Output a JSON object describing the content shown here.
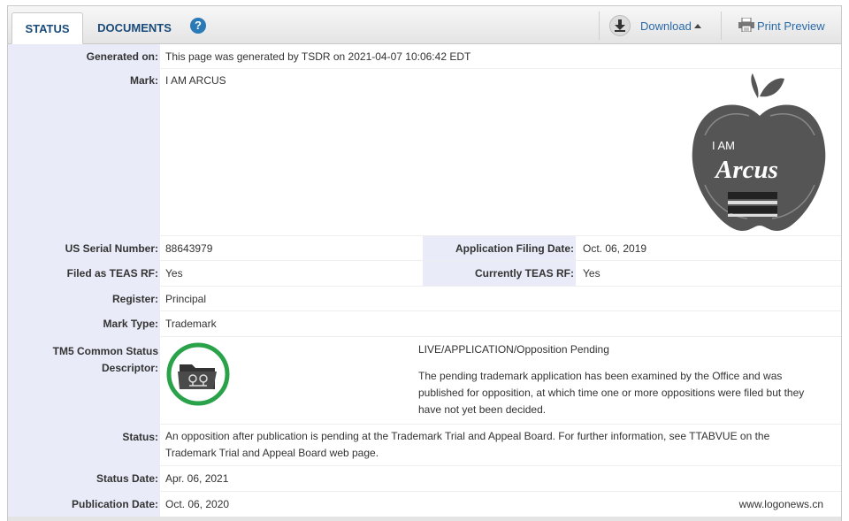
{
  "tabs": {
    "status": "STATUS",
    "documents": "DOCUMENTS",
    "help": "?"
  },
  "toolbar": {
    "download": "Download",
    "print_preview": "Print Preview"
  },
  "generated_on": {
    "label": "Generated on:",
    "value": "This page was generated by TSDR on 2021-04-07 10:06:42 EDT"
  },
  "mark": {
    "label": "Mark:",
    "value": "I AM ARCUS",
    "logo_text_small": "I AM",
    "logo_text_large": "Arcus"
  },
  "serial": {
    "label": "US Serial Number:",
    "value": "88643979"
  },
  "filing_date": {
    "label": "Application Filing Date:",
    "value": "Oct. 06, 2019"
  },
  "teas_rf": {
    "label": "Filed as TEAS RF:",
    "value": "Yes"
  },
  "current_teas": {
    "label": "Currently TEAS RF:",
    "value": "Yes"
  },
  "register": {
    "label": "Register:",
    "value": "Principal"
  },
  "mark_type": {
    "label": "Mark Type:",
    "value": "Trademark"
  },
  "tm5": {
    "label_line1": "TM5 Common Status",
    "label_line2": "Descriptor:",
    "status_title": "LIVE/APPLICATION/Opposition Pending",
    "desc_line1": "The pending trademark application has been examined by the Office and was",
    "desc_line2": "published for opposition, at which time one or more oppositions were filed but they",
    "desc_line3": "have not yet been decided."
  },
  "status": {
    "label": "Status:",
    "line1": "An opposition after publication is pending at the Trademark Trial and Appeal Board. For further information, see TTABVUE on the",
    "line2": "Trademark Trial and Appeal Board web page."
  },
  "status_date": {
    "label": "Status Date:",
    "value": "Apr. 06, 2021"
  },
  "publication_date": {
    "label": "Publication Date:",
    "value": "Oct. 06, 2020"
  },
  "watermark": "www.logonews.cn",
  "colors": {
    "label_bg": "#e9ecf8",
    "link": "#2a6aa8",
    "tab_text": "#1a4b7a",
    "status_green": "#2aa24a",
    "logo_gray": "#555555"
  }
}
